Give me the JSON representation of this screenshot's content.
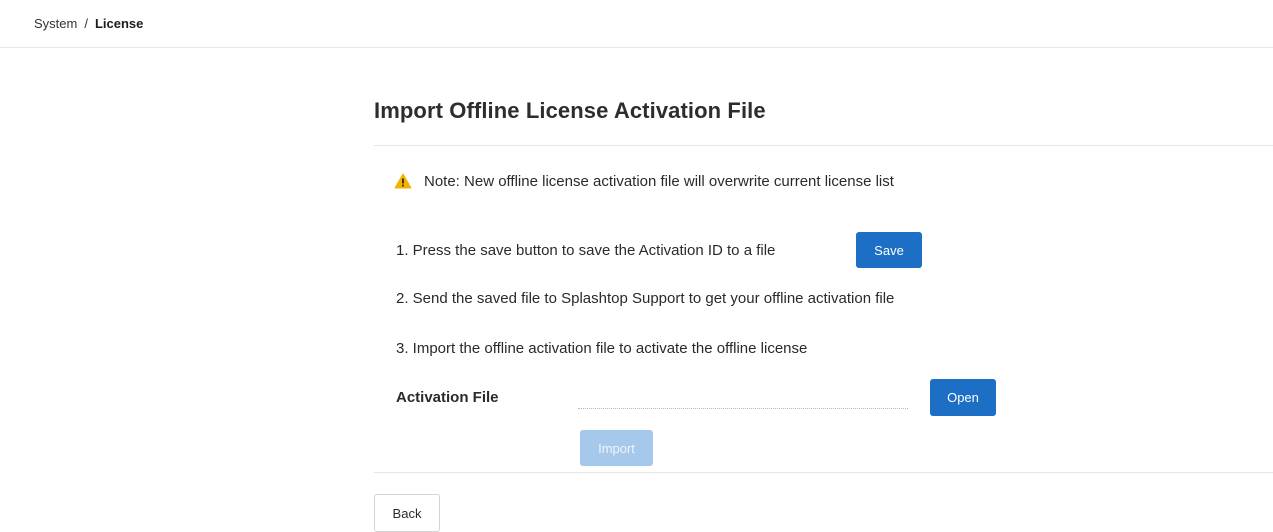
{
  "breadcrumb": {
    "parent": "System",
    "separator": "/",
    "current": "License"
  },
  "page": {
    "title": "Import Offline License Activation File"
  },
  "note": {
    "icon": "warning-icon",
    "icon_color": "#f0b400",
    "text": "Note: New offline license activation file will overwrite current license list"
  },
  "steps": [
    {
      "text": "1. Press the save button to save the Activation ID to a file"
    },
    {
      "text": "2. Send the saved file to Splashtop Support to get your offline activation file"
    },
    {
      "text": "3. Import the offline activation file to activate the offline license"
    }
  ],
  "buttons": {
    "save_label": "Save",
    "open_label": "Open",
    "import_label": "Import",
    "back_label": "Back"
  },
  "activation_file": {
    "label": "Activation File",
    "value": ""
  },
  "colors": {
    "primary": "#1c6fc4",
    "primary_disabled": "#a6c8ea"
  }
}
